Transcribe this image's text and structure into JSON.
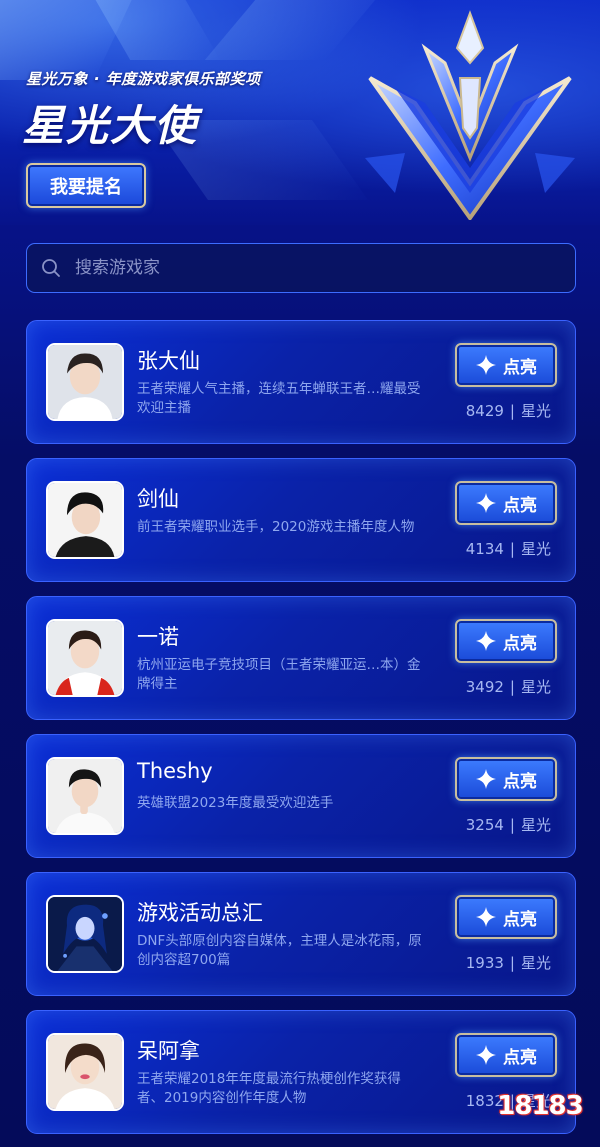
{
  "hero": {
    "subtitle": "星光万象 · 年度游戏家俱乐部奖项",
    "title": "星光大使",
    "nominate_label": "我要提名"
  },
  "search": {
    "placeholder": "搜索游戏家"
  },
  "cards": [
    {
      "name": "张大仙",
      "desc": "王者荣耀人气主播，连续五年蝉联王者…耀最受欢迎主播",
      "button": "点亮",
      "count": "8429",
      "unit": "星光"
    },
    {
      "name": "剑仙",
      "desc": "前王者荣耀职业选手，2020游戏主播年度人物",
      "button": "点亮",
      "count": "4134",
      "unit": "星光"
    },
    {
      "name": "一诺",
      "desc": "杭州亚运电子竞技项目（王者荣耀亚运…本）金牌得主",
      "button": "点亮",
      "count": "3492",
      "unit": "星光"
    },
    {
      "name": "Theshy",
      "desc": "英雄联盟2023年度最受欢迎选手",
      "button": "点亮",
      "count": "3254",
      "unit": "星光"
    },
    {
      "name": "游戏活动总汇",
      "desc": "DNF头部原创内容自媒体，主理人是冰花雨，原创内容超700篇",
      "button": "点亮",
      "count": "1933",
      "unit": "星光"
    },
    {
      "name": "呆阿拿",
      "desc": "王者荣耀2018年年度最流行热梗创作奖获得者、2019内容创作年度人物",
      "button": "点亮",
      "count": "1832",
      "unit": "星光"
    }
  ],
  "watermark": "18183",
  "colors": {
    "accent": "#3c6cff",
    "button_border": "#c7bea0",
    "description": "#8fa7ef"
  },
  "icons": {
    "search": "search-icon",
    "light": "four-point-star-icon"
  }
}
